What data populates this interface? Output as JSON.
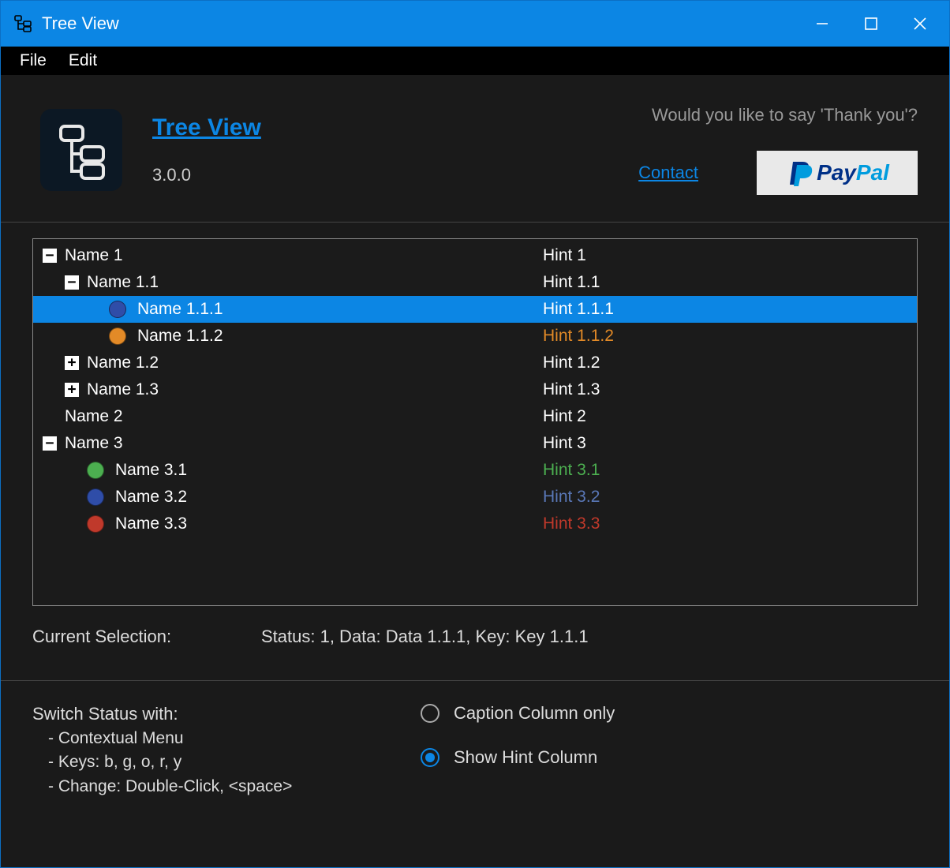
{
  "window": {
    "title": "Tree View"
  },
  "menu": {
    "file": "File",
    "edit": "Edit"
  },
  "header": {
    "app_title": "Tree View",
    "version": "3.0.0",
    "thankyou": "Would you like to say 'Thank you'?",
    "contact": "Contact",
    "paypal_pay": "Pay",
    "paypal_pal": "Pal"
  },
  "tree": {
    "items": [
      {
        "indent": 0,
        "expander": "-",
        "dot": null,
        "name": "Name 1",
        "hint": "Hint 1",
        "hint_color": "#fff",
        "selected": false
      },
      {
        "indent": 1,
        "expander": "-",
        "dot": null,
        "name": "Name 1.1",
        "hint": "Hint 1.1",
        "hint_color": "#fff",
        "selected": false
      },
      {
        "indent": 2,
        "expander": null,
        "dot": "#2f4da8",
        "name": "Name 1.1.1",
        "hint": "Hint 1.1.1",
        "hint_color": "#fff",
        "selected": true
      },
      {
        "indent": 2,
        "expander": null,
        "dot": "#e38a27",
        "name": "Name 1.1.2",
        "hint": "Hint 1.1.2",
        "hint_color": "#e38a27",
        "selected": false
      },
      {
        "indent": 1,
        "expander": "+",
        "dot": null,
        "name": "Name 1.2",
        "hint": "Hint 1.2",
        "hint_color": "#fff",
        "selected": false
      },
      {
        "indent": 1,
        "expander": "+",
        "dot": null,
        "name": "Name 1.3",
        "hint": "Hint 1.3",
        "hint_color": "#fff",
        "selected": false
      },
      {
        "indent": 0,
        "expander": null,
        "dot": null,
        "name": "Name 2",
        "hint": "Hint 2",
        "hint_color": "#fff",
        "selected": false
      },
      {
        "indent": 0,
        "expander": "-",
        "dot": null,
        "name": "Name 3",
        "hint": "Hint 3",
        "hint_color": "#fff",
        "selected": false
      },
      {
        "indent": 1,
        "expander": null,
        "dot": "#4caf50",
        "name": "Name 3.1",
        "hint": "Hint 3.1",
        "hint_color": "#4caf50",
        "selected": false
      },
      {
        "indent": 1,
        "expander": null,
        "dot": "#2f4da8",
        "name": "Name 3.2",
        "hint": "Hint 3.2",
        "hint_color": "#5a78b8",
        "selected": false
      },
      {
        "indent": 1,
        "expander": null,
        "dot": "#c0392b",
        "name": "Name 3.3",
        "hint": "Hint 3.3",
        "hint_color": "#c0392b",
        "selected": false
      }
    ]
  },
  "selection": {
    "label": "Current Selection:",
    "value": "Status: 1, Data: Data 1.1.1, Key: Key 1.1.1"
  },
  "help": {
    "title": "Switch Status with:",
    "line1": "- Contextual Menu",
    "line2": "- Keys: b, g, o, r, y",
    "line3": "- Change: Double-Click, <space>"
  },
  "radios": {
    "opt1": {
      "label": "Caption Column only",
      "checked": false
    },
    "opt2": {
      "label": "Show Hint Column",
      "checked": true
    }
  }
}
